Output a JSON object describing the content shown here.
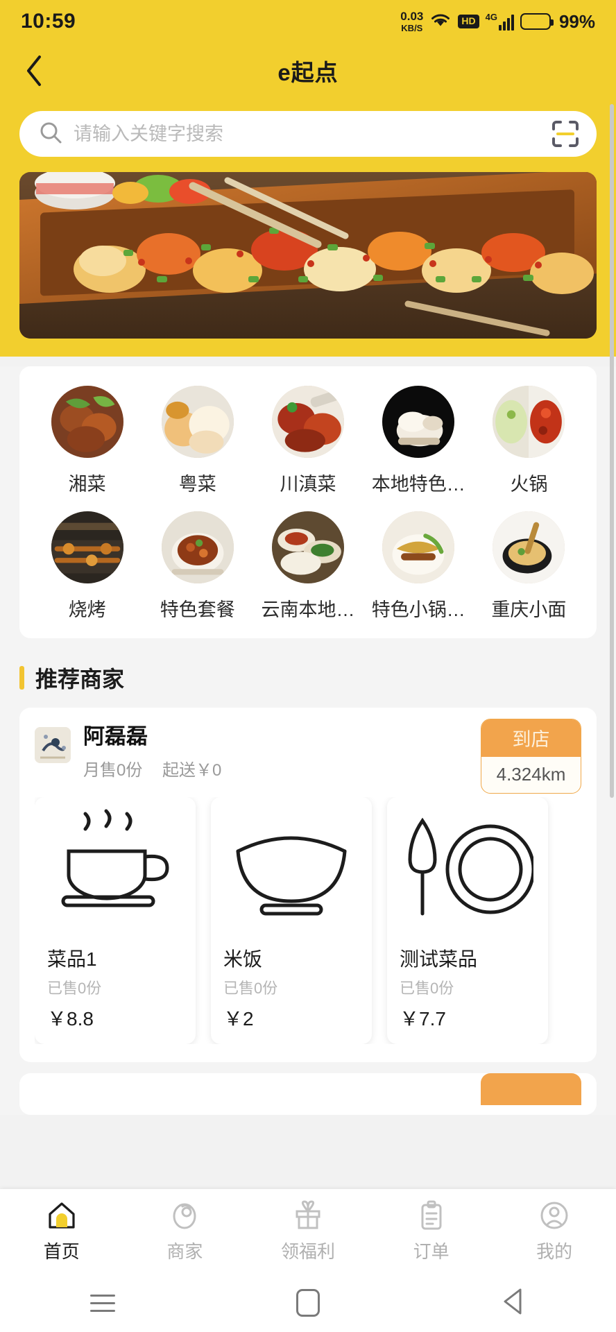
{
  "status_bar": {
    "time": "10:59",
    "net_speed_value": "0.03",
    "net_speed_unit": "KB/S",
    "hd_label": "HD",
    "network_label": "4G",
    "battery_percent": "99%"
  },
  "header": {
    "title": "e起点",
    "back_icon": "chevron-left-icon",
    "bg_color": "#f2cf2e"
  },
  "search": {
    "placeholder": "请输入关键字搜索",
    "value": "",
    "search_icon": "search-icon",
    "scan_icon": "scan-qr-icon"
  },
  "banner": {
    "alt": "street food grill banner"
  },
  "categories": [
    {
      "label": "湘菜",
      "icon": "category-image"
    },
    {
      "label": "粤菜",
      "icon": "category-image"
    },
    {
      "label": "川滇菜",
      "icon": "category-image"
    },
    {
      "label": "本地特色…",
      "icon": "category-image"
    },
    {
      "label": "火锅",
      "icon": "category-image"
    },
    {
      "label": "烧烤",
      "icon": "category-image"
    },
    {
      "label": "特色套餐",
      "icon": "category-image"
    },
    {
      "label": "云南本地…",
      "icon": "category-image"
    },
    {
      "label": "特色小锅…",
      "icon": "category-image"
    },
    {
      "label": "重庆小面",
      "icon": "category-image"
    }
  ],
  "section": {
    "title": "推荐商家",
    "accent_color": "#f2c431"
  },
  "merchant": {
    "name": "阿磊磊",
    "monthly_sales": "月售0份",
    "delivery_min": "起送￥0",
    "badge_label": "到店",
    "badge_distance": "4.324km",
    "badge_color": "#f2a44c",
    "dishes": [
      {
        "name": "菜品1",
        "sold": "已售0份",
        "price": "￥8.8",
        "icon": "coffee-cup-icon"
      },
      {
        "name": "米饭",
        "sold": "已售0份",
        "price": "￥2",
        "icon": "rice-bowl-icon"
      },
      {
        "name": "测试菜品",
        "sold": "已售0份",
        "price": "￥7.7",
        "icon": "plate-knife-icon"
      }
    ]
  },
  "tabbar": [
    {
      "label": "首页",
      "icon": "home-icon",
      "active": true
    },
    {
      "label": "商家",
      "icon": "shop-icon",
      "active": false
    },
    {
      "label": "领福利",
      "icon": "gift-icon",
      "active": false
    },
    {
      "label": "订单",
      "icon": "clipboard-icon",
      "active": false
    },
    {
      "label": "我的",
      "icon": "user-icon",
      "active": false
    }
  ],
  "android_nav": {
    "menu_icon": "menu-icon",
    "home_icon": "square-home-icon",
    "back_icon": "triangle-back-icon"
  }
}
